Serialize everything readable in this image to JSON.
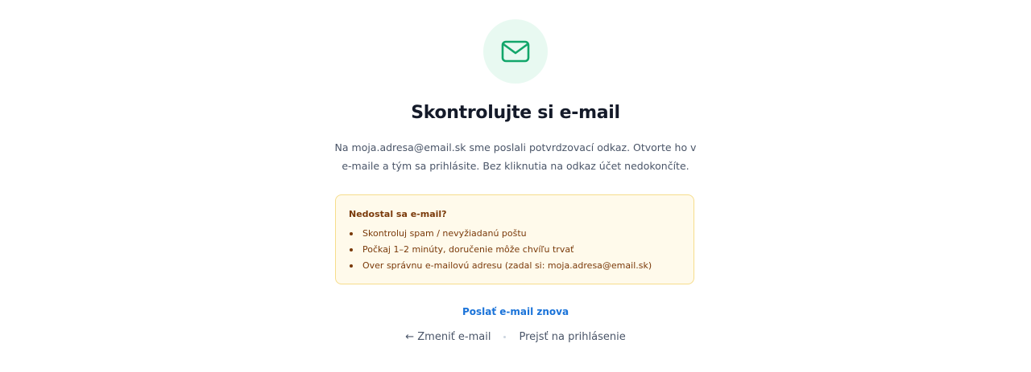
{
  "icon": {
    "name": "mail-icon",
    "color": "#12a66a",
    "background": "#e8f9f1"
  },
  "title": "Skontrolujte si e-mail",
  "description": {
    "line1": "Na moja.adresa@email.sk sme poslali potvrdzovací odkaz. Otvorte ho v",
    "line2": "e-maile a tým sa prihlásite. Bez kliknutia na odkaz účet nedokončíte."
  },
  "notice": {
    "title": "Nedostal sa e-mail?",
    "items": [
      "Skontroluj spam / nevyžiadanú poštu",
      "Počkaj 1–2 minúty, doručenie môže chvíľu trvať",
      "Over správnu e-mailovú adresu (zadal si: moja.adresa@email.sk)"
    ]
  },
  "actions": {
    "resend_label": "Poslať e-mail znova",
    "change_email_label": "← Zmeniť e-mail",
    "go_to_login_label": "Prejsť na prihlásenie"
  },
  "colors": {
    "title": "#141a29",
    "body_text": "#4a5568",
    "link": "#1a73d9",
    "notice_bg": "#fffaeb",
    "notice_border": "#f6dd8c",
    "notice_text": "#7a3a0a"
  }
}
